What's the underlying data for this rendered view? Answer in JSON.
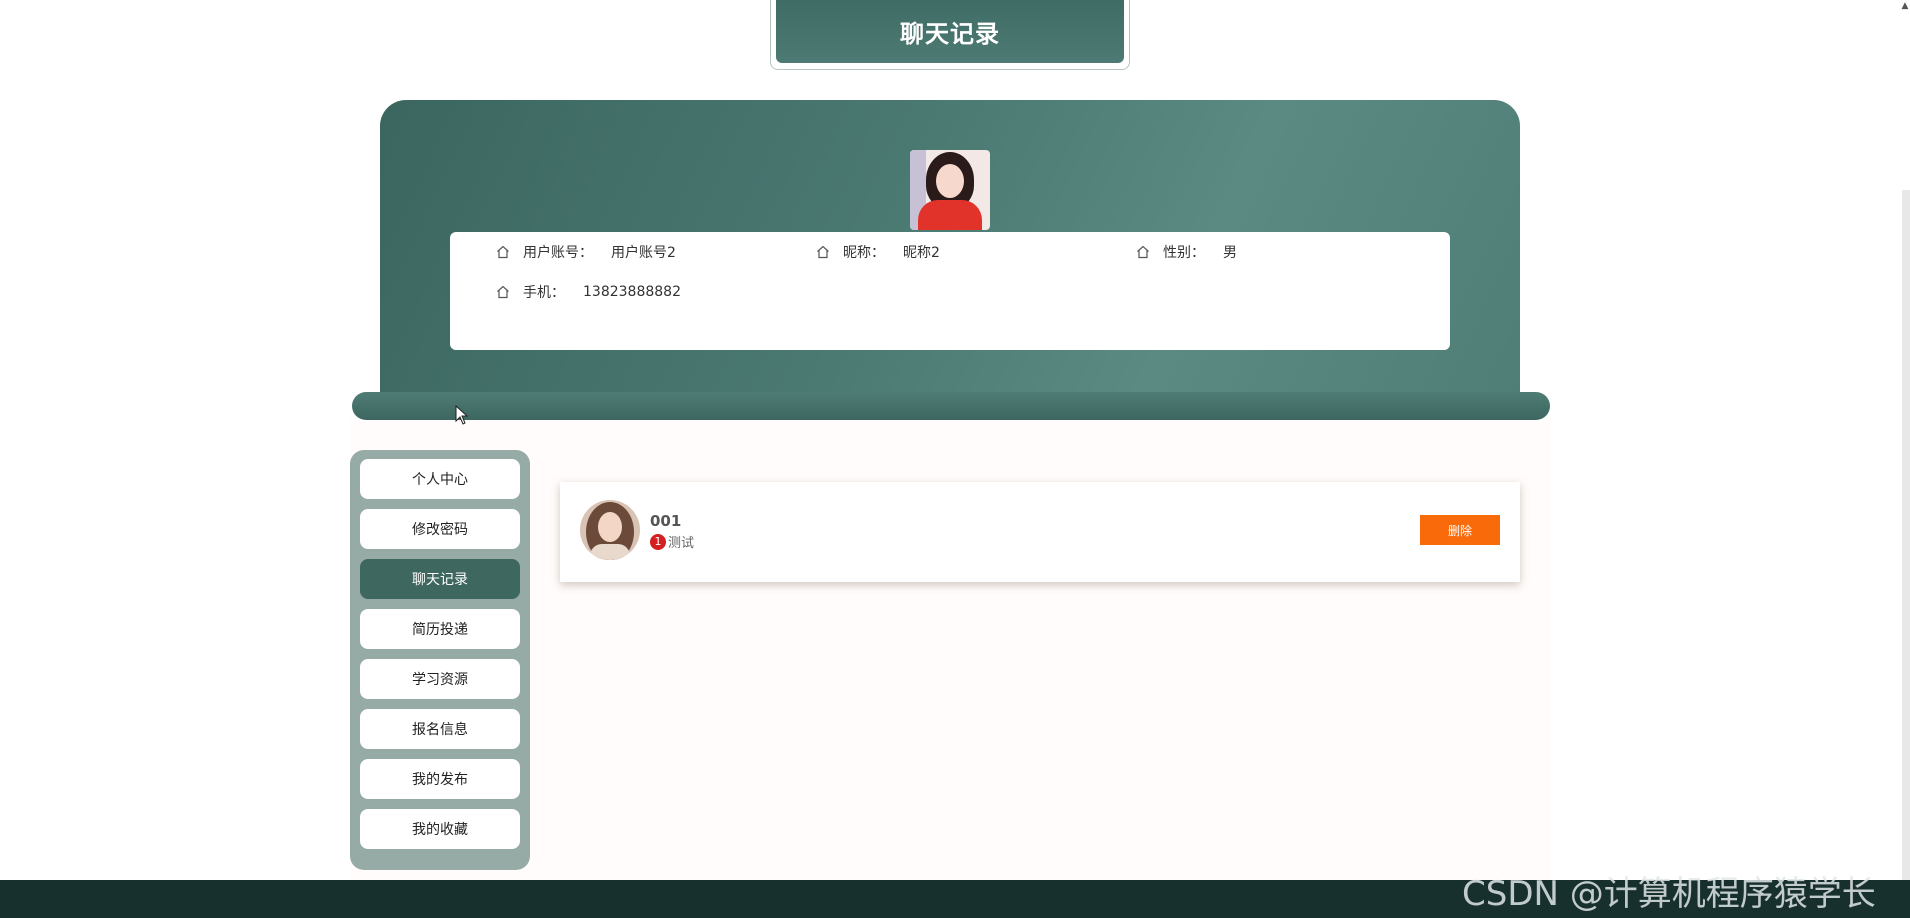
{
  "page": {
    "title": "聊天记录"
  },
  "profile": {
    "account_label": "用户账号：",
    "account_value": "用户账号2",
    "nickname_label": "昵称：",
    "nickname_value": "昵称2",
    "gender_label": "性别：",
    "gender_value": "男",
    "phone_label": "手机：",
    "phone_value": "13823888882",
    "field_icon": "home-icon"
  },
  "sidebar": {
    "items": [
      {
        "label": "个人中心",
        "active": false
      },
      {
        "label": "修改密码",
        "active": false
      },
      {
        "label": "聊天记录",
        "active": true
      },
      {
        "label": "简历投递",
        "active": false
      },
      {
        "label": "学习资源",
        "active": false
      },
      {
        "label": "报名信息",
        "active": false
      },
      {
        "label": "我的发布",
        "active": false
      },
      {
        "label": "我的收藏",
        "active": false
      }
    ]
  },
  "chat": {
    "name": "001",
    "unread": "1",
    "message": "测试",
    "delete_label": "删除"
  },
  "footer": {
    "watermark": "CSDN @计算机程序猿学长"
  },
  "colors": {
    "primary": "#3e6760",
    "sidebar_bg": "#97aba6",
    "delete": "#f96a0a",
    "badge": "#d42020",
    "footer": "#17302e"
  }
}
